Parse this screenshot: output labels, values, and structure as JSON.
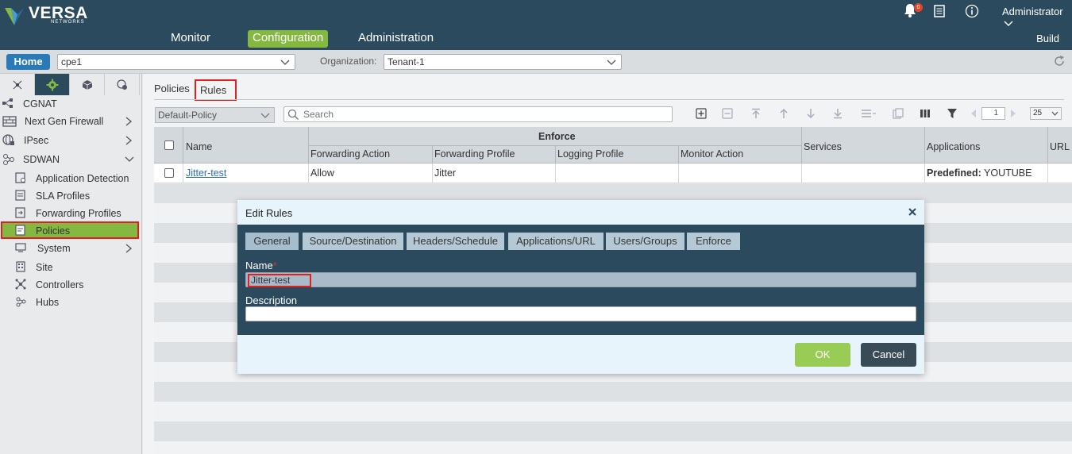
{
  "app": {
    "logo_text": "VERSA",
    "logo_subtext": "NETWORKS",
    "notification_count": "0",
    "user_menu": "Administrator",
    "build_label": "Build"
  },
  "nav": {
    "monitor": "Monitor",
    "configuration": "Configuration",
    "administration": "Administration"
  },
  "subbar": {
    "home_label": "Home",
    "device_value": "cpe1",
    "org_label": "Organization:",
    "org_value": "Tenant-1"
  },
  "sidebar": {
    "items": [
      {
        "label": "CGNAT"
      },
      {
        "label": "Next Gen Firewall"
      },
      {
        "label": "IPsec"
      },
      {
        "label": "SDWAN"
      },
      {
        "label": "Application Detection"
      },
      {
        "label": "SLA Profiles"
      },
      {
        "label": "Forwarding Profiles"
      },
      {
        "label": "Policies"
      },
      {
        "label": "System"
      },
      {
        "label": "Site"
      },
      {
        "label": "Controllers"
      },
      {
        "label": "Hubs"
      }
    ]
  },
  "main": {
    "tabs": [
      {
        "label": "Policies"
      },
      {
        "label": "Rules"
      }
    ],
    "policy_select": "Default-Policy",
    "search_placeholder": "Search",
    "page_number": "1",
    "per_page": "25"
  },
  "table": {
    "headers": {
      "name": "Name",
      "enforce": "Enforce",
      "forwarding_action": "Forwarding Action",
      "forwarding_profile": "Forwarding Profile",
      "logging_profile": "Logging Profile",
      "monitor_action": "Monitor Action",
      "services": "Services",
      "applications": "Applications",
      "url": "URL"
    },
    "rows": [
      {
        "name": "Jitter-test",
        "forwarding_action": "Allow",
        "forwarding_profile": "Jitter",
        "logging_profile": "",
        "monitor_action": "",
        "services": "",
        "applications_label": "Predefined:",
        "applications_value": "YOUTUBE"
      }
    ]
  },
  "modal": {
    "title": "Edit Rules",
    "tabs": [
      {
        "label": "General"
      },
      {
        "label": "Source/Destination"
      },
      {
        "label": "Headers/Schedule"
      },
      {
        "label": "Applications/URL"
      },
      {
        "label": "Users/Groups"
      },
      {
        "label": "Enforce"
      }
    ],
    "name_label": "Name",
    "name_required": "*",
    "name_value": "Jitter-test",
    "description_label": "Description",
    "description_value": "",
    "ok_label": "OK",
    "cancel_label": "Cancel"
  },
  "colors": {
    "header_bg": "#2c4a5e",
    "accent_green": "#84b840",
    "home_blue": "#2a7ab8",
    "highlight_red": "#e02020"
  }
}
